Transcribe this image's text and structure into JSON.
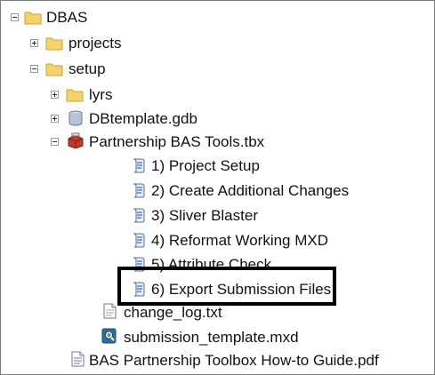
{
  "tree": {
    "root": {
      "label": "DBAS",
      "expander": "minus",
      "icon": "folder-icon"
    },
    "projects": {
      "label": "projects",
      "expander": "plus",
      "icon": "folder-icon"
    },
    "setup": {
      "label": "setup",
      "expander": "minus",
      "icon": "folder-icon"
    },
    "lyrs": {
      "label": "lyrs",
      "expander": "plus",
      "icon": "folder-icon"
    },
    "gdb": {
      "label": "DBtemplate.gdb",
      "expander": "plus",
      "icon": "database-icon"
    },
    "toolbox": {
      "label": "Partnership BAS Tools.tbx",
      "expander": "minus",
      "icon": "toolbox-icon"
    },
    "tools": [
      {
        "label": "1) Project Setup",
        "icon": "script-tool-icon"
      },
      {
        "label": "2) Create Additional Changes",
        "icon": "script-tool-icon"
      },
      {
        "label": "3) Sliver Blaster",
        "icon": "script-tool-icon"
      },
      {
        "label": "4) Reformat Working MXD",
        "icon": "script-tool-icon"
      },
      {
        "label": "5) Attribute Check",
        "icon": "script-tool-icon"
      },
      {
        "label": "6) Export Submission Files",
        "icon": "script-tool-icon"
      }
    ],
    "files": [
      {
        "label": "change_log.txt",
        "icon": "text-file-icon"
      },
      {
        "label": "submission_template.mxd",
        "icon": "map-document-icon"
      }
    ],
    "guide": {
      "label": "BAS Partnership Toolbox How-to Guide.pdf",
      "icon": "pdf-file-icon"
    }
  },
  "colors": {
    "folder": "#f3d36b",
    "folder_dark": "#c9a233",
    "highlight_border": "#000000"
  }
}
